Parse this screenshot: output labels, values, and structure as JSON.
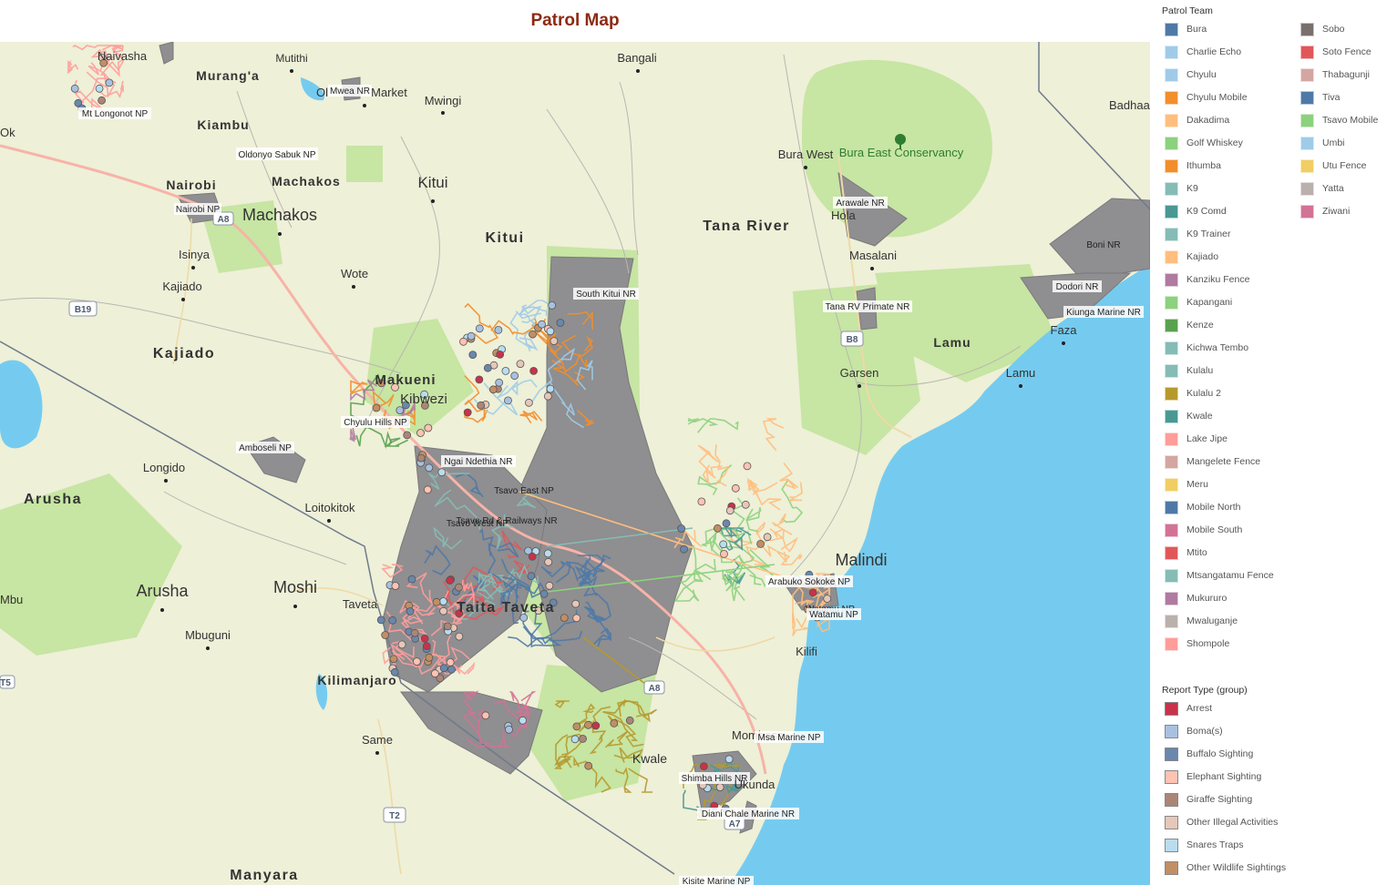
{
  "title": "Patrol Map",
  "colors": {
    "title": "#8c2a12",
    "water": "#75cbef",
    "land": "#eef0d8",
    "park": "#c7e5a3",
    "protected_area": "#8f8e90"
  },
  "map": {
    "place_labels": [
      "Mutithi",
      "Murang'a",
      "Bangali",
      "Kiambu",
      "Mwingi",
      "Oldonyo Sabuk NP",
      "Nairobi",
      "Machakos",
      "Kitui",
      "Nairobi NP",
      "Machakos",
      "Kitui",
      "Isinya",
      "Wote",
      "Kajiado",
      "Kajiado",
      "Makueni",
      "Kibwezi",
      "Chyulu Hills NP",
      "Amboseli NP",
      "Longido",
      "Arusha",
      "Loitokitok",
      "Moshi",
      "Arusha",
      "Mbu",
      "Mbuguni",
      "Kilimanjaro",
      "Same",
      "Manyara",
      "Taita Taveta",
      "Taveta",
      "Tana River",
      "Bura West",
      "Bura East Conservancy",
      "Arawale NR",
      "Hola",
      "Masalani",
      "Tana RV Primate NR",
      "Garsen",
      "Lamu",
      "Lamu",
      "Faza",
      "Kiunga Marine NR",
      "Dodori NR",
      "Boni NR",
      "Badhaa",
      "Malindi",
      "Kilifi",
      "Arabuko Sokoke NP",
      "Watamu NR",
      "Watamu NP",
      "Mombasa",
      "Msa Marine NP",
      "Shimba Hills NR",
      "Kwale",
      "Ukunda",
      "Diani Chale Marine NR",
      "Kisite Marine NP",
      "South Kitui NR",
      "Ngai Ndethia NR",
      "Tsavo East NP",
      "Tsavo Rd & Railways NR",
      "Tsavo West NP",
      "Mwea NR",
      "Mt Longonot NP",
      "Naivasha",
      "Ok",
      "Market",
      "Ol"
    ],
    "road_shields": [
      "B19",
      "A8",
      "B8",
      "T2",
      "A7",
      "A8",
      "T5"
    ]
  },
  "legend": {
    "patrol_title": "Patrol Team",
    "patrol_teams": [
      {
        "name": "Bura",
        "color": "#4e79a7"
      },
      {
        "name": "Charlie Echo",
        "color": "#a0cbe8"
      },
      {
        "name": "Chyulu",
        "color": "#a0cbe8"
      },
      {
        "name": "Chyulu Mobile",
        "color": "#f28e2b"
      },
      {
        "name": "Dakadima",
        "color": "#ffbe7d"
      },
      {
        "name": "Golf Whiskey",
        "color": "#8cd17d"
      },
      {
        "name": "Ithumba",
        "color": "#f28e2b"
      },
      {
        "name": "K9",
        "color": "#86bcb6"
      },
      {
        "name": "K9 Comd",
        "color": "#499894"
      },
      {
        "name": "K9 Trainer",
        "color": "#86bcb6"
      },
      {
        "name": "Kajiado",
        "color": "#ffbe7d"
      },
      {
        "name": "Kanziku Fence",
        "color": "#b07aa1"
      },
      {
        "name": "Kapangani",
        "color": "#8cd17d"
      },
      {
        "name": "Kenze",
        "color": "#59a14f"
      },
      {
        "name": "Kichwa Tembo",
        "color": "#86bcb6"
      },
      {
        "name": "Kulalu",
        "color": "#86bcb6"
      },
      {
        "name": "Kulalu 2",
        "color": "#b6992d"
      },
      {
        "name": "Kwale",
        "color": "#499894"
      },
      {
        "name": "Lake Jipe",
        "color": "#ff9d9a"
      },
      {
        "name": "Mangelete Fence",
        "color": "#d4a6a2"
      },
      {
        "name": "Meru",
        "color": "#f1ce63"
      },
      {
        "name": "Mobile North",
        "color": "#4e79a7"
      },
      {
        "name": "Mobile South",
        "color": "#d37295"
      },
      {
        "name": "Mtito",
        "color": "#e15759"
      },
      {
        "name": "Mtsangatamu Fence",
        "color": "#86bcb6"
      },
      {
        "name": "Mukururo",
        "color": "#b07aa1"
      },
      {
        "name": "Mwaluganje",
        "color": "#bab0ac"
      },
      {
        "name": "Shompole",
        "color": "#ff9d9a"
      },
      {
        "name": "Sobo",
        "color": "#79706e"
      },
      {
        "name": "Soto Fence",
        "color": "#e15759"
      },
      {
        "name": "Thabagunji",
        "color": "#d4a6a2"
      },
      {
        "name": "Tiva",
        "color": "#4e79a7"
      },
      {
        "name": "Tsavo Mobile",
        "color": "#8cd17d"
      },
      {
        "name": "Umbi",
        "color": "#a0cbe8"
      },
      {
        "name": "Utu Fence",
        "color": "#f1ce63"
      },
      {
        "name": "Yatta",
        "color": "#bab0ac"
      },
      {
        "name": "Ziwani",
        "color": "#d37295"
      }
    ],
    "report_title": "Report Type (group)",
    "report_types": [
      {
        "name": "Arrest",
        "color": "#c8324b"
      },
      {
        "name": "Boma(s)",
        "color": "#a8c1e0"
      },
      {
        "name": "Buffalo Sighting",
        "color": "#6a87ad"
      },
      {
        "name": "Elephant Sighting",
        "color": "#ffc2b3"
      },
      {
        "name": "Giraffe Sighting",
        "color": "#ab8677"
      },
      {
        "name": "Other Illegal Activities",
        "color": "#e6c7b9"
      },
      {
        "name": "Snares Traps",
        "color": "#b9dcef"
      },
      {
        "name": "Other Wildlife Sightings",
        "color": "#c28e63"
      }
    ]
  }
}
